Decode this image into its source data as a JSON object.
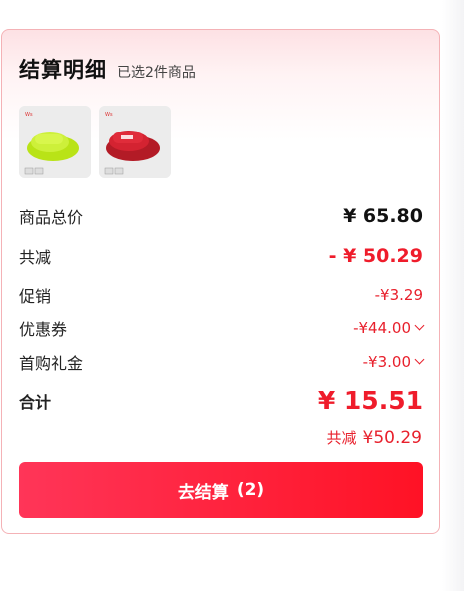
{
  "header": {
    "title": "结算明细",
    "subtitle": "已选2件商品"
  },
  "products": [
    {
      "color": "#c8ef2a",
      "icon": "lime-slipper-product-image"
    },
    {
      "color": "#d21f2e",
      "icon": "red-slipper-product-image"
    }
  ],
  "summary": {
    "subtotal": {
      "label": "商品总价",
      "value": "¥ 65.80"
    },
    "discount_total": {
      "label": "共减",
      "value": "- ¥ 50.29"
    },
    "promotion": {
      "label": "促销",
      "value": "-¥3.29"
    },
    "coupon": {
      "label": "优惠券",
      "value": "-¥44.00"
    },
    "first_purchase": {
      "label": "首购礼金",
      "value": "-¥3.00"
    },
    "total": {
      "label": "合计",
      "value": "¥ 15.51"
    },
    "saved": {
      "label": "共减",
      "value": "¥50.29"
    }
  },
  "checkout": {
    "label": "去结算",
    "count": "(2)"
  },
  "colors": {
    "accent": "#ef1c2b",
    "button_start": "#ff3558",
    "button_end": "#ff1225"
  }
}
